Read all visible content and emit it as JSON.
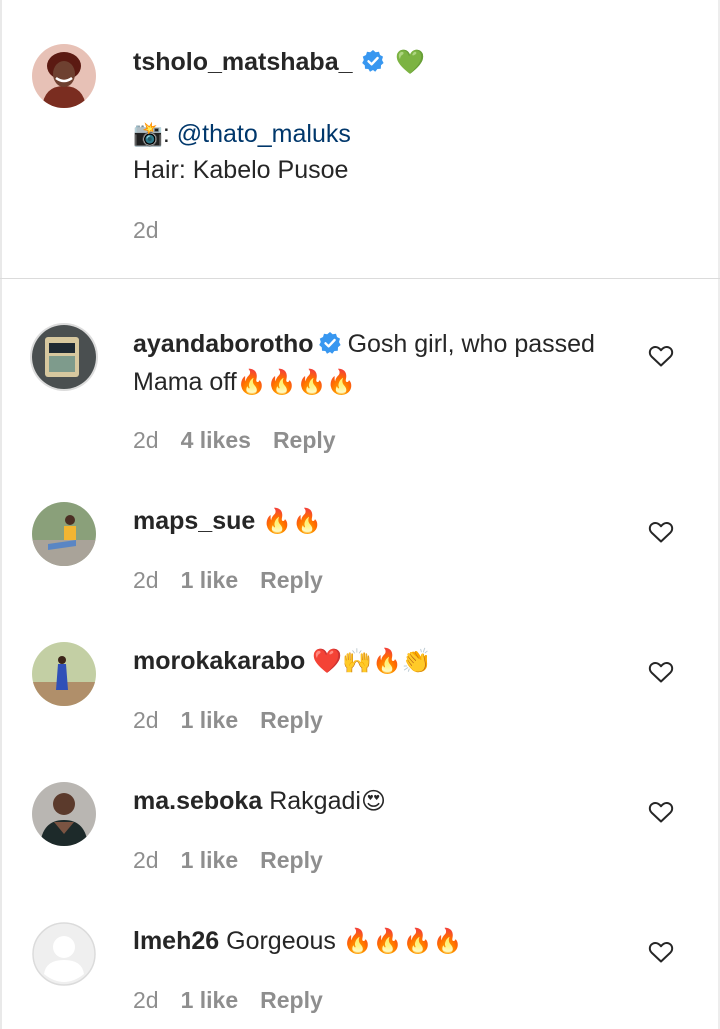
{
  "post": {
    "username": "tsholo_matshaba_",
    "trailing_emoji": "💚",
    "caption_lines": [
      {
        "emoji": "📸",
        "prefix": ": ",
        "mention": "@thato_maluks"
      },
      {
        "text": "Hair: Kabelo Pusoe"
      }
    ],
    "age": "2d"
  },
  "comments": [
    {
      "username": "ayandaborotho",
      "verified": true,
      "text": "Gosh girl, who passed Mama off",
      "emojis": "🔥🔥🔥🔥",
      "age": "2d",
      "likes": "4 likes",
      "reply": "Reply"
    },
    {
      "username": "maps_sue",
      "verified": false,
      "text": "",
      "emojis": "🔥🔥",
      "age": "2d",
      "likes": "1 like",
      "reply": "Reply"
    },
    {
      "username": "morokakarabo",
      "verified": false,
      "text": "",
      "emojis": "❤️🙌🔥👏",
      "age": "2d",
      "likes": "1 like",
      "reply": "Reply"
    },
    {
      "username": "ma.seboka",
      "verified": false,
      "text": "Rakgadi",
      "emojis": "😍",
      "age": "2d",
      "likes": "1 like",
      "reply": "Reply"
    },
    {
      "username": "lmeh26",
      "verified": false,
      "text": "Gorgeous",
      "emojis": "🔥🔥🔥🔥",
      "age": "2d",
      "likes": "1 like",
      "reply": "Reply"
    }
  ],
  "icons": {
    "like": "heart-outline-icon",
    "verified": "verified-badge-icon"
  },
  "colors": {
    "verified_blue": "#3897f0",
    "mention_blue": "#00376b",
    "meta_gray": "#8e8e8e"
  }
}
